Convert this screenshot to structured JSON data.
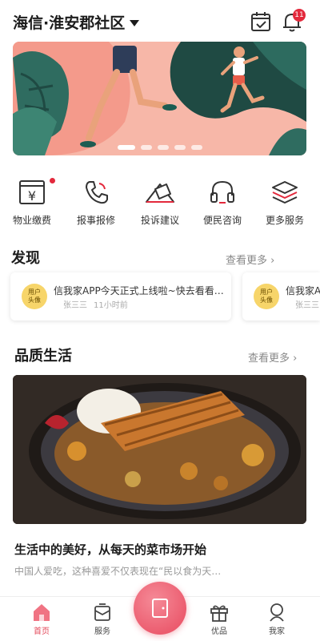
{
  "header": {
    "community": "海信·淮安郡社区",
    "notification_count": "11"
  },
  "banner": {
    "page_count": 5,
    "active_index": 0
  },
  "services": [
    {
      "label": "物业缴费",
      "icon": "yen-card-icon",
      "has_dot": true
    },
    {
      "label": "报事报修",
      "icon": "phone-icon",
      "has_dot": false
    },
    {
      "label": "投诉建议",
      "icon": "complaint-note-icon",
      "has_dot": false
    },
    {
      "label": "便民咨询",
      "icon": "headset-icon",
      "has_dot": false
    },
    {
      "label": "更多服务",
      "icon": "layers-icon",
      "has_dot": false
    }
  ],
  "discover": {
    "title": "发现",
    "see_more": "查看更多",
    "cards": [
      {
        "avatar": "用户\n头像",
        "title": "信我家APP今天正式上线啦~快去看看…",
        "author": "张三三",
        "time": "11小时前"
      },
      {
        "avatar": "用户\n头像",
        "title": "信我家A",
        "author": "张三三",
        "time": "11"
      }
    ]
  },
  "quality": {
    "title": "品质生活",
    "see_more": "查看更多",
    "article_title": "生活中的美好，从每天的菜市场开始",
    "article_excerpt": "中国人爱吃，这种喜爱不仅表现在“民以食为天…"
  },
  "tabbar": {
    "items": [
      {
        "label": "首页",
        "active": true
      },
      {
        "label": "服务",
        "active": false
      },
      {
        "label": "优品",
        "active": false
      },
      {
        "label": "我家",
        "active": false
      }
    ]
  },
  "colors": {
    "accent": "#e3293c",
    "tab_active": "#e3485a",
    "banner_bg": "#f6b3a6"
  }
}
